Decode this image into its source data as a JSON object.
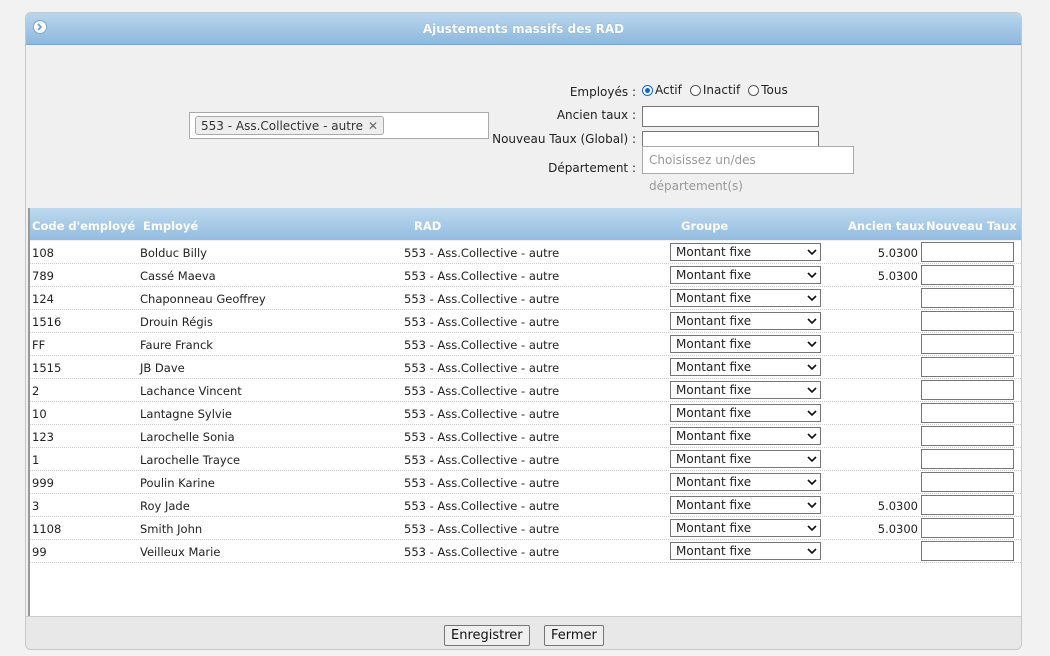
{
  "window": {
    "title": "Ajustements massifs des RAD"
  },
  "filters": {
    "selected_tag": "553 - Ass.Collective - autre",
    "employes_label": "Employés :",
    "status_options": [
      {
        "label": "Actif",
        "checked": true
      },
      {
        "label": "Inactif",
        "checked": false
      },
      {
        "label": "Tous",
        "checked": false
      }
    ],
    "ancien_taux_label": "Ancien taux :",
    "ancien_taux_value": "",
    "nouveau_taux_label": "Nouveau Taux (Global) :",
    "nouveau_taux_value": "",
    "departement_label": "Département :",
    "departement_placeholder": "Choisissez un/des département(s)"
  },
  "table": {
    "headers": {
      "code": "Code d'employé",
      "employe": "Employé",
      "rad": "RAD",
      "groupe": "Groupe",
      "ancien": "Ancien taux",
      "nouveau": "Nouveau Taux"
    },
    "rows": [
      {
        "code": "108",
        "employe": "Bolduc Billy",
        "rad": "553 - Ass.Collective - autre",
        "groupe": "Montant fixe",
        "ancien": "5.0300",
        "nouveau": ""
      },
      {
        "code": "789",
        "employe": "Cassé Maeva",
        "rad": "553 - Ass.Collective - autre",
        "groupe": "Montant fixe",
        "ancien": "5.0300",
        "nouveau": ""
      },
      {
        "code": "124",
        "employe": "Chaponneau Geoffrey",
        "rad": "553 - Ass.Collective - autre",
        "groupe": "Montant fixe",
        "ancien": "",
        "nouveau": ""
      },
      {
        "code": "1516",
        "employe": "Drouin Régis",
        "rad": "553 - Ass.Collective - autre",
        "groupe": "Montant fixe",
        "ancien": "",
        "nouveau": ""
      },
      {
        "code": "FF",
        "employe": "Faure Franck",
        "rad": "553 - Ass.Collective - autre",
        "groupe": "Montant fixe",
        "ancien": "",
        "nouveau": ""
      },
      {
        "code": "1515",
        "employe": "JB Dave",
        "rad": "553 - Ass.Collective - autre",
        "groupe": "Montant fixe",
        "ancien": "",
        "nouveau": ""
      },
      {
        "code": "2",
        "employe": "Lachance Vincent",
        "rad": "553 - Ass.Collective - autre",
        "groupe": "Montant fixe",
        "ancien": "",
        "nouveau": ""
      },
      {
        "code": "10",
        "employe": "Lantagne Sylvie",
        "rad": "553 - Ass.Collective - autre",
        "groupe": "Montant fixe",
        "ancien": "",
        "nouveau": ""
      },
      {
        "code": "123",
        "employe": "Larochelle Sonia",
        "rad": "553 - Ass.Collective - autre",
        "groupe": "Montant fixe",
        "ancien": "",
        "nouveau": ""
      },
      {
        "code": "1",
        "employe": "Larochelle Trayce",
        "rad": "553 - Ass.Collective - autre",
        "groupe": "Montant fixe",
        "ancien": "",
        "nouveau": ""
      },
      {
        "code": "999",
        "employe": "Poulin Karine",
        "rad": "553 - Ass.Collective - autre",
        "groupe": "Montant fixe",
        "ancien": "",
        "nouveau": ""
      },
      {
        "code": "3",
        "employe": "Roy Jade",
        "rad": "553 - Ass.Collective - autre",
        "groupe": "Montant fixe",
        "ancien": "5.0300",
        "nouveau": ""
      },
      {
        "code": "1108",
        "employe": "Smith John",
        "rad": "553 - Ass.Collective - autre",
        "groupe": "Montant fixe",
        "ancien": "5.0300",
        "nouveau": ""
      },
      {
        "code": "99",
        "employe": "Veilleux Marie",
        "rad": "553 - Ass.Collective - autre",
        "groupe": "Montant fixe",
        "ancien": "",
        "nouveau": ""
      }
    ]
  },
  "footer": {
    "save_label": "Enregistrer",
    "close_label": "Fermer"
  },
  "icons": {
    "title": "circle-chevron-right-icon",
    "remove_tag": "close-icon",
    "select": "chevron-down-icon"
  }
}
